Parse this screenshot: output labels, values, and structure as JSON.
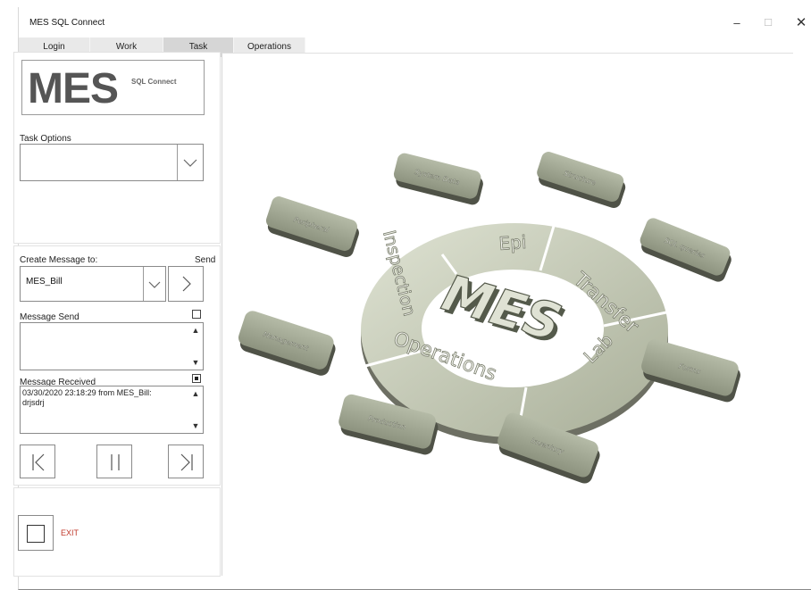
{
  "window": {
    "title": "MES SQL Connect",
    "minimize_glyph": "–",
    "maximize_glyph": "☐",
    "close_glyph": "✕"
  },
  "tabs": [
    {
      "label": "Login"
    },
    {
      "label": "Work"
    },
    {
      "label": "Task"
    },
    {
      "label": "Operations"
    }
  ],
  "logo": {
    "main": "MES",
    "sub": "SQL Connect"
  },
  "task_options": {
    "label": "Task Options",
    "value": "",
    "dropdown_icon": "chevron-down-icon"
  },
  "message": {
    "create_label": "Create Message to:",
    "send_label": "Send",
    "recipient": "MES_Bill",
    "send_section_label": "Message Send",
    "send_text": "",
    "send_checked": false,
    "received_label": "Message Received",
    "received_checked": true,
    "received_text": "03/30/2020  23:18:29 from MES_Bill: drjsdrj"
  },
  "controls": {
    "first": "|<",
    "pause": "||",
    "last": ">|"
  },
  "exit": {
    "label": "EXIT",
    "color": "#c0392b"
  },
  "diagram": {
    "center": "MES",
    "ring": [
      "Epi",
      "Transfer",
      "Lab",
      "Operations",
      "Inspection"
    ],
    "tiles": [
      "System Data",
      "Structure",
      "SQL queries",
      "Forms",
      "Inventory",
      "Production",
      "Management",
      "Peripheral"
    ],
    "tile_color": "#9aa08e",
    "ring_color": "#c7ccb9"
  }
}
